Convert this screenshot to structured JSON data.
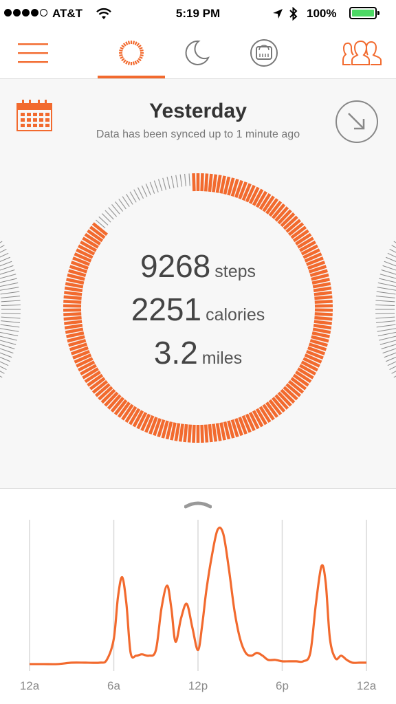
{
  "status_bar": {
    "carrier": "AT&T",
    "time": "5:19 PM",
    "battery": "100%",
    "signal_bars": 4
  },
  "nav": {
    "tabs": [
      {
        "id": "activity",
        "icon": "activity-ring-icon",
        "active": true
      },
      {
        "id": "sleep",
        "icon": "moon-icon",
        "active": false
      },
      {
        "id": "scale",
        "icon": "scale-icon",
        "active": false
      }
    ],
    "menu_icon": "hamburger-menu-icon",
    "friends_icon": "friends-icon",
    "accent_color": "#f26a2e"
  },
  "summary": {
    "title": "Yesterday",
    "sync_text": "Data has been synced up to 1 minute ago",
    "calendar_icon": "calendar-icon",
    "share_icon": "arrow-down-right-icon",
    "goal_progress": 0.93,
    "stats": [
      {
        "value": "9268",
        "unit": "steps"
      },
      {
        "value": "2251",
        "unit": "calories"
      },
      {
        "value": "3.2",
        "unit": "miles"
      }
    ]
  },
  "chart_data": {
    "type": "line",
    "x_tick_labels": [
      "12a",
      "6a",
      "12p",
      "6p",
      "12a"
    ],
    "xlim": [
      0,
      24
    ],
    "grid": "vertical",
    "color": "#f26a2e",
    "x": [
      0,
      1,
      2,
      3,
      4,
      5,
      5.5,
      6,
      6.3,
      6.6,
      6.9,
      7.2,
      7.6,
      8.0,
      8.5,
      9.0,
      9.4,
      9.8,
      10.1,
      10.4,
      10.8,
      11.2,
      11.6,
      12.0,
      12.3,
      12.6,
      13.0,
      13.4,
      13.8,
      14.2,
      14.6,
      15.0,
      15.4,
      15.8,
      16.2,
      16.6,
      17.0,
      17.5,
      18.0,
      18.5,
      19.0,
      19.5,
      20.0,
      20.4,
      20.8,
      21.1,
      21.4,
      21.8,
      22.2,
      22.6,
      23.0,
      23.5,
      24.0
    ],
    "y": [
      0.02,
      0.02,
      0.02,
      0.03,
      0.03,
      0.03,
      0.05,
      0.2,
      0.5,
      0.64,
      0.45,
      0.1,
      0.08,
      0.09,
      0.08,
      0.12,
      0.42,
      0.58,
      0.42,
      0.18,
      0.35,
      0.45,
      0.28,
      0.12,
      0.3,
      0.55,
      0.8,
      0.98,
      0.95,
      0.7,
      0.4,
      0.2,
      0.1,
      0.08,
      0.1,
      0.08,
      0.05,
      0.05,
      0.04,
      0.04,
      0.04,
      0.04,
      0.1,
      0.45,
      0.72,
      0.6,
      0.2,
      0.06,
      0.08,
      0.05,
      0.03,
      0.03,
      0.03
    ],
    "ylim": [
      0,
      1.08
    ]
  }
}
